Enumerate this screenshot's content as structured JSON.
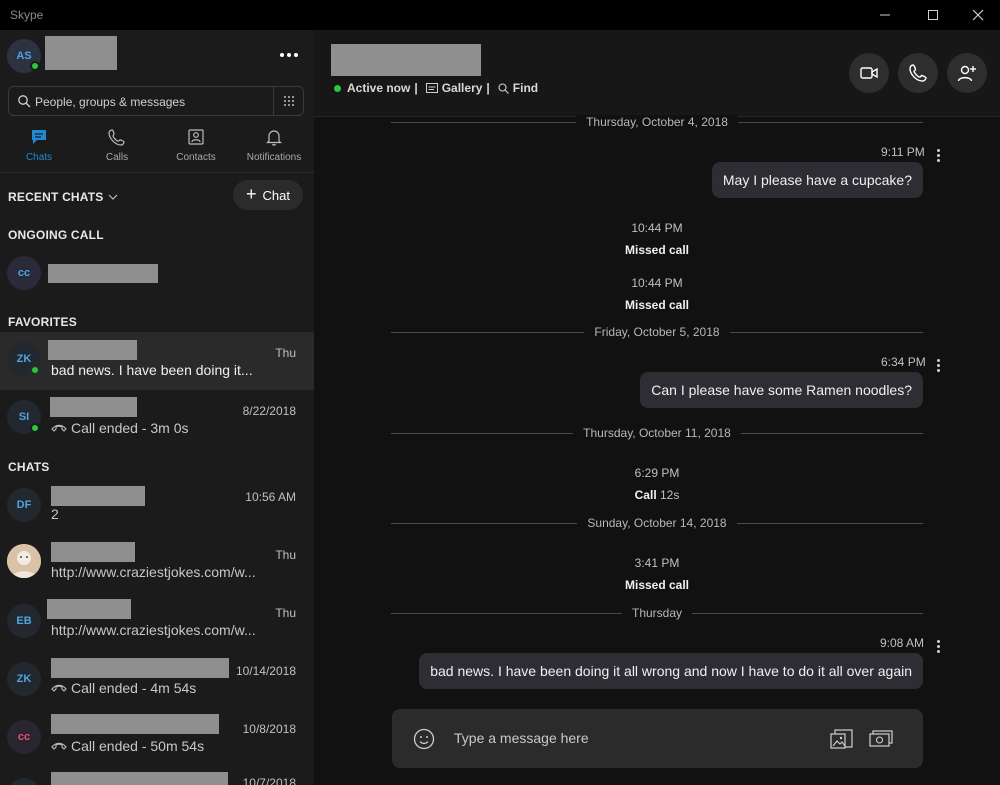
{
  "window": {
    "title": "Skype"
  },
  "profile": {
    "initials": "AS"
  },
  "search": {
    "placeholder": "People, groups & messages"
  },
  "nav": {
    "tabs": [
      {
        "label": "Chats",
        "icon": "chat-icon",
        "active": true
      },
      {
        "label": "Calls",
        "icon": "phone-icon",
        "active": false
      },
      {
        "label": "Contacts",
        "icon": "contacts-icon",
        "active": false
      },
      {
        "label": "Notifications",
        "icon": "bell-icon",
        "active": false
      }
    ]
  },
  "sections": {
    "recent_chats": "RECENT CHATS",
    "new_chat_button": "Chat",
    "ongoing_call": "ONGOING CALL",
    "favorites": "FAVORITES",
    "chats": "CHATS"
  },
  "ongoing_call": {
    "initials": "cc"
  },
  "favorites": [
    {
      "initials": "ZK",
      "time": "Thu",
      "preview": "bad news.  I have been doing it...",
      "online": true,
      "selected": true
    },
    {
      "initials": "SI",
      "time": "8/22/2018",
      "preview": "Call ended - 3m 0s",
      "online": true,
      "selected": false
    }
  ],
  "chats": [
    {
      "initials": "DF",
      "time": "10:56 AM",
      "preview": "2"
    },
    {
      "initials": "",
      "time": "Thu",
      "preview": "http://www.craziestjokes.com/w..."
    },
    {
      "initials": "EB",
      "time": "Thu",
      "preview": "http://www.craziestjokes.com/w..."
    },
    {
      "initials": "ZK",
      "time": "10/14/2018",
      "preview": "Call ended - 4m 54s"
    },
    {
      "initials": "cc",
      "time": "10/8/2018",
      "preview": "Call ended - 50m 54s"
    },
    {
      "initials": "",
      "time": "10/7/2018",
      "preview": ""
    }
  ],
  "conversation": {
    "status": {
      "active": "Active now",
      "gallery": "Gallery",
      "find": "Find",
      "separator": "|"
    },
    "date_separators": [
      "Thursday, October 4, 2018",
      "Friday, October 5, 2018",
      "Thursday, October 11, 2018",
      "Sunday, October 14, 2018",
      "Thursday"
    ],
    "messages": [
      {
        "time": "9:11 PM",
        "text": "May I please have a cupcake?"
      },
      {
        "time": "6:34 PM",
        "text": "Can I please have some Ramen noodles?"
      },
      {
        "time": "9:08 AM",
        "text": "bad news.  I have been doing it all wrong and now I have to do it all over again"
      }
    ],
    "call_events": [
      {
        "time": "10:44 PM",
        "label": "Missed call",
        "duration": ""
      },
      {
        "time": "10:44 PM",
        "label": "Missed call",
        "duration": ""
      },
      {
        "time": "6:29 PM",
        "label": "Call",
        "duration": "12s"
      },
      {
        "time": "3:41 PM",
        "label": "Missed call",
        "duration": ""
      }
    ]
  },
  "composer": {
    "placeholder": "Type a message here"
  },
  "colors": {
    "accent": "#1f8ad1",
    "online": "#27c83d",
    "sidebar_bg": "#1b1b1b",
    "main_bg": "#111111",
    "bubble_bg": "#2d2d33"
  }
}
